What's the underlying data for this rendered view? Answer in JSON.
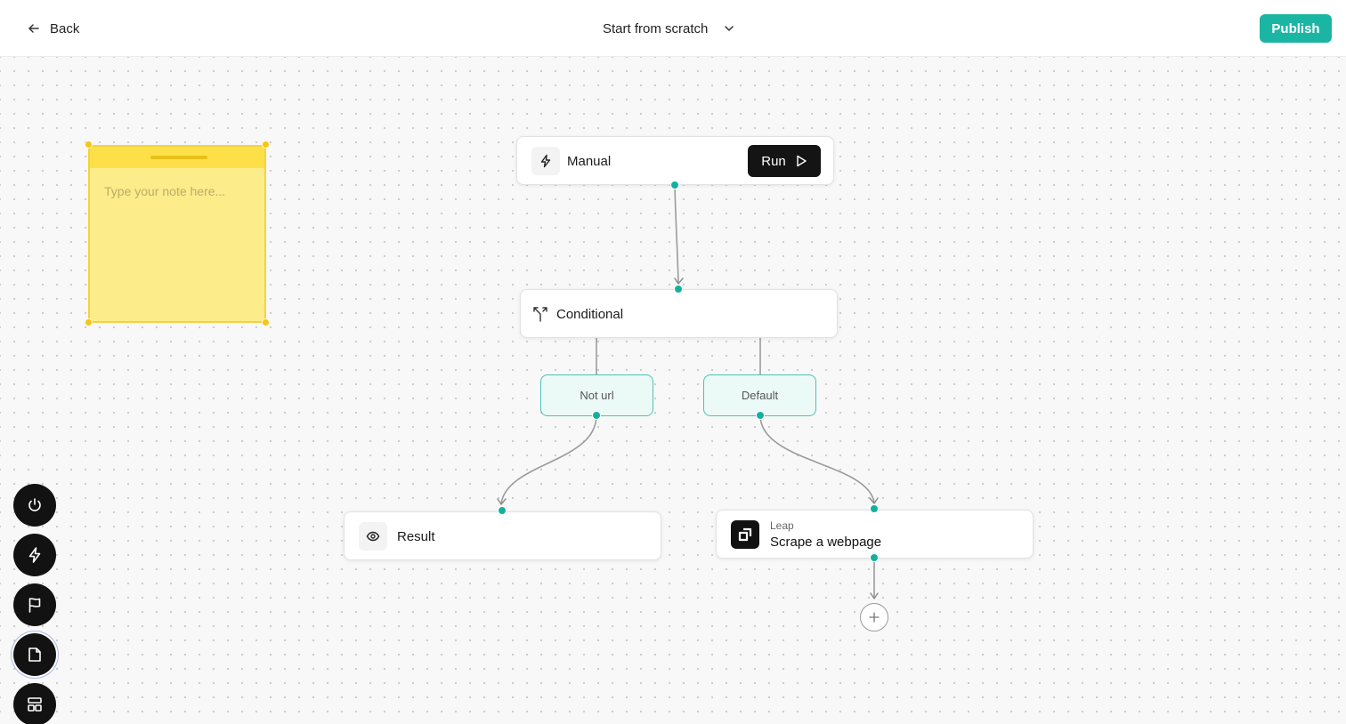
{
  "header": {
    "back_label": "Back",
    "template_label": "Start from scratch",
    "publish_label": "Publish"
  },
  "note": {
    "placeholder": "Type your note here..."
  },
  "nodes": {
    "manual": {
      "title": "Manual",
      "run_label": "Run",
      "icon": "lightning-icon"
    },
    "conditional": {
      "title": "Conditional",
      "icon": "split-arrows-icon"
    },
    "branch_not_url": {
      "label": "Not url"
    },
    "branch_default": {
      "label": "Default"
    },
    "result": {
      "title": "Result",
      "icon": "eye-icon"
    },
    "scrape": {
      "provider": "Leap",
      "title": "Scrape a webpage",
      "icon": "leap-logo-icon"
    }
  },
  "toolbar": {
    "tools": [
      "power-icon",
      "lightning-icon",
      "flag-icon",
      "note-icon",
      "layout-icon"
    ],
    "active": "note-icon"
  },
  "colors": {
    "accent": "#1bb5a4",
    "note_fill": "#fdec8a",
    "note_border": "#f5d33a",
    "branch_fill": "#ecfaf7",
    "port": "#14b09f"
  }
}
